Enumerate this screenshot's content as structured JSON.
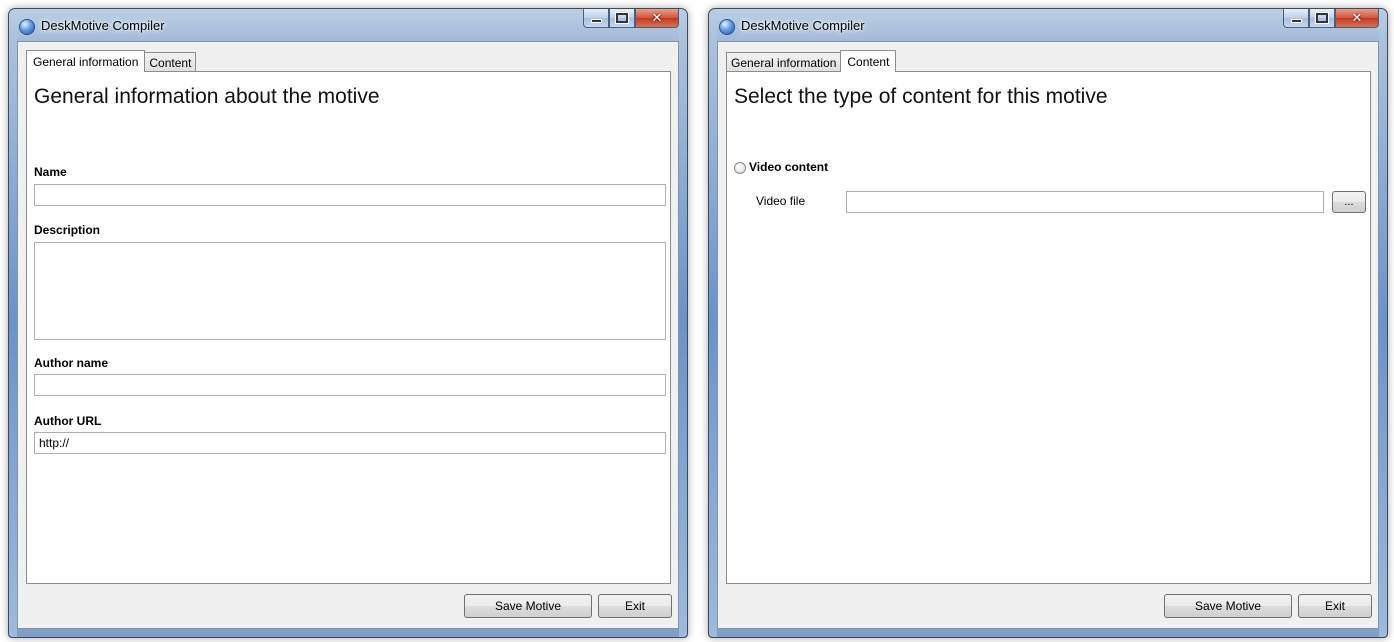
{
  "windows": [
    {
      "title": "DeskMotive Compiler",
      "tabs": [
        "General information",
        "Content"
      ],
      "active_tab": "General information",
      "heading": "General information about the motive",
      "fields": {
        "name_label": "Name",
        "name_value": "",
        "description_label": "Description",
        "description_value": "",
        "author_name_label": "Author name",
        "author_name_value": "",
        "author_url_label": "Author URL",
        "author_url_value": "http://"
      },
      "buttons": {
        "save": "Save Motive",
        "exit": "Exit"
      }
    },
    {
      "title": "DeskMotive Compiler",
      "tabs": [
        "General information",
        "Content"
      ],
      "active_tab": "Content",
      "heading": "Select the type of content for this motive",
      "video": {
        "radio_label": "Video content",
        "selected": false,
        "file_label": "Video file",
        "file_value": "",
        "browse_label": "..."
      },
      "buttons": {
        "save": "Save Motive",
        "exit": "Exit"
      }
    }
  ],
  "caption_icons": [
    "minimize-icon",
    "maximize-icon",
    "close-icon"
  ]
}
